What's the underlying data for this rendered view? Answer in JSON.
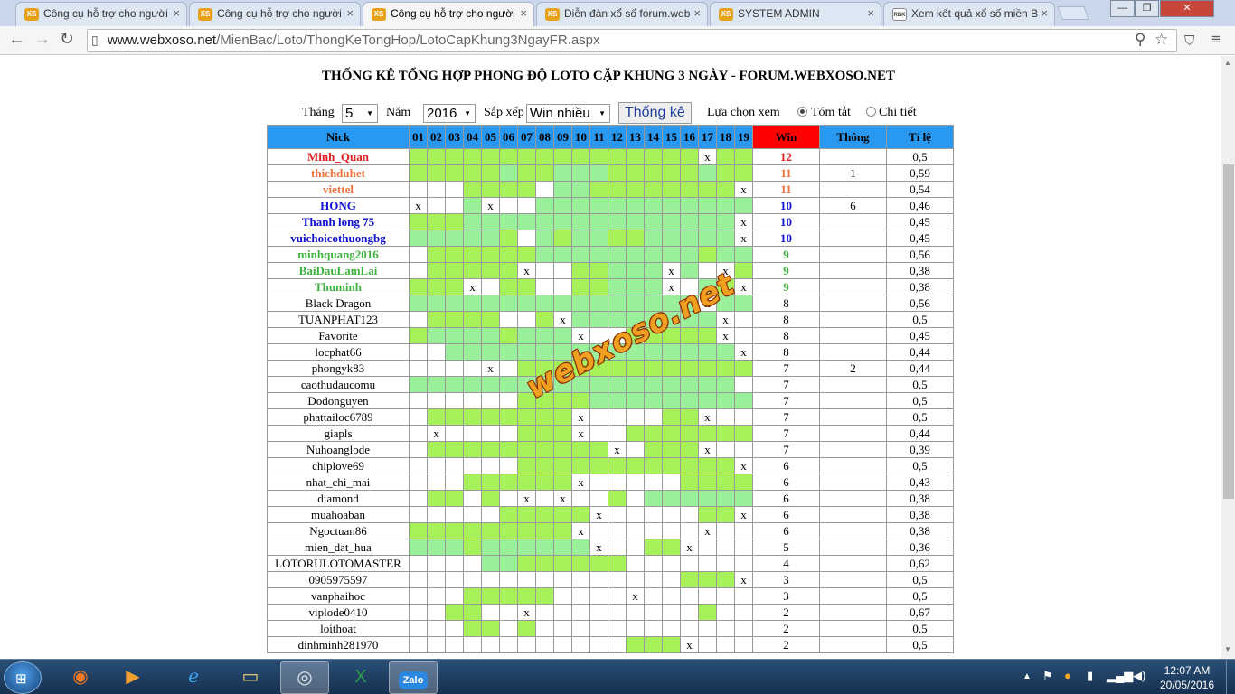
{
  "browser": {
    "tabs": [
      {
        "title": "Công cụ hỗ trợ cho người",
        "icon": "XS",
        "active": false
      },
      {
        "title": "Công cụ hỗ trợ cho người",
        "icon": "XS",
        "active": false
      },
      {
        "title": "Công cụ hỗ trợ cho người",
        "icon": "XS",
        "active": true
      },
      {
        "title": "Diễn đàn xổ số forum.web",
        "icon": "XS",
        "active": false
      },
      {
        "title": "SYSTEM ADMIN",
        "icon": "XS",
        "active": false
      },
      {
        "title": "Xem kết quả xổ số miền B",
        "icon": "RBK",
        "active": false
      }
    ],
    "url_host": "www.webxoso.net",
    "url_path": "/MienBac/Loto/ThongKeTongHop/LotoCapKhung3NgayFR.aspx"
  },
  "page": {
    "title": "THỐNG KÊ TỔNG HỢP PHONG ĐỘ LOTO CẶP KHUNG 3 NGÀY - FORUM.WEBXOSO.NET",
    "form": {
      "month_label": "Tháng",
      "month_value": "5",
      "year_label": "Năm",
      "year_value": "2016",
      "sort_label": "Sắp xếp",
      "sort_value": "Win nhiều",
      "submit_label": "Thống kê",
      "view_label": "Lựa chọn xem",
      "view_summary": "Tóm tắt",
      "view_detail": "Chi tiết"
    },
    "watermark": "webxoso.net",
    "table": {
      "headers": {
        "nick": "Nick",
        "win": "Win",
        "thong": "Thông",
        "ratio": "Tỉ lệ"
      },
      "days": [
        "01",
        "02",
        "03",
        "04",
        "05",
        "06",
        "07",
        "08",
        "09",
        "10",
        "11",
        "12",
        "13",
        "14",
        "15",
        "16",
        "17",
        "18",
        "19"
      ],
      "rows": [
        {
          "nick": "Minh_Quan",
          "cells": "GGGGGGGGGGGGGGGGxGG",
          "win": "12",
          "thong": "",
          "ratio": "0,5",
          "color": "#e02020",
          "bold": true
        },
        {
          "nick": "thichduhet",
          "cells": "GGGGGLGGLLLGGGGGLGG",
          "win": "11",
          "thong": "1",
          "ratio": "0,59",
          "color": "#f07040",
          "bold": true
        },
        {
          "nick": "viettel",
          "cells": "   GGGG LLGGGGGGGGx",
          "win": "11",
          "thong": "",
          "ratio": "0,54",
          "color": "#f07040",
          "bold": true
        },
        {
          "nick": "HONG",
          "cells": "x  Lx  LLLLLLLLLLLL",
          "win": "10",
          "thong": "6",
          "ratio": "0,46",
          "color": "#1010d0",
          "bold": true
        },
        {
          "nick": "Thanh long 75",
          "cells": "GGGLLLLLLLLLLLLLLLx",
          "win": "10",
          "thong": "",
          "ratio": "0,45",
          "color": "#1010d0",
          "bold": true
        },
        {
          "nick": "vuichoicothuongbg",
          "cells": "LLLLLG LGLLGGLLLLLx",
          "win": "10",
          "thong": "",
          "ratio": "0,45",
          "color": "#1010d0",
          "bold": true
        },
        {
          "nick": "minhquang2016",
          "cells": " GGGGGGLLLLLLLLLGLL",
          "win": "9",
          "thong": "",
          "ratio": "0,56",
          "color": "#40b040",
          "bold": true
        },
        {
          "nick": "BaiDauLamLai",
          "cells": " GGGGGx  GGLLLxL xG",
          "win": "9",
          "thong": "",
          "ratio": "0,38",
          "color": "#40b040",
          "bold": true
        },
        {
          "nick": "Thuminh",
          "cells": "GGGx GG  GGLLLx LGx",
          "win": "9",
          "thong": "",
          "ratio": "0,38",
          "color": "#40b040",
          "bold": true
        },
        {
          "nick": "Black Dragon",
          "cells": "LLLLLLLLLLLLLLLLxLL",
          "win": "8",
          "thong": "",
          "ratio": "0,56",
          "color": "#000",
          "bold": false
        },
        {
          "nick": "TUANPHAT123",
          "cells": " GGGG  GxLLLLLLLLx ",
          "win": "8",
          "thong": "",
          "ratio": "0,5",
          "color": "#000",
          "bold": false
        },
        {
          "nick": "Favorite",
          "cells": "GLLLLGLLLx  GGGGGx ",
          "win": "8",
          "thong": "",
          "ratio": "0,45",
          "color": "#000",
          "bold": false
        },
        {
          "nick": "locphat66",
          "cells": "  LLLLLLLLLLLLLLLLx",
          "win": "8",
          "thong": "",
          "ratio": "0,44",
          "color": "#000",
          "bold": false
        },
        {
          "nick": "phongyk83",
          "cells": "    x GGGGGGGGGGGGG",
          "win": "7",
          "thong": "2",
          "ratio": "0,44",
          "color": "#000",
          "bold": false
        },
        {
          "nick": "caothudaucomu",
          "cells": "LLLLLLLLLLLLLLLLLL ",
          "win": "7",
          "thong": "",
          "ratio": "0,5",
          "color": "#000",
          "bold": false
        },
        {
          "nick": "Dodonguyen",
          "cells": "      GGGGLLLLLLLLL",
          "win": "7",
          "thong": "",
          "ratio": "0,5",
          "color": "#000",
          "bold": false
        },
        {
          "nick": "phattailoc6789",
          "cells": " GGGGGGGGx    GGx  ",
          "win": "7",
          "thong": "",
          "ratio": "0,5",
          "color": "#000",
          "bold": false
        },
        {
          "nick": "giapls",
          "cells": " x    GGGx  GGGGGGG",
          "win": "7",
          "thong": "",
          "ratio": "0,44",
          "color": "#000",
          "bold": false
        },
        {
          "nick": "Nuhoanglode",
          "cells": " GGGGGGGGGGx GGGx  ",
          "win": "7",
          "thong": "",
          "ratio": "0,39",
          "color": "#000",
          "bold": false
        },
        {
          "nick": "chiplove69",
          "cells": "      GGGGGGGGGGGGx",
          "win": "6",
          "thong": "",
          "ratio": "0,5",
          "color": "#000",
          "bold": false
        },
        {
          "nick": "nhat_chi_mai",
          "cells": "   GGGGGGx     GGGG",
          "win": "6",
          "thong": "",
          "ratio": "0,43",
          "color": "#000",
          "bold": false
        },
        {
          "nick": "diamond",
          "cells": " GG G x x  G LLLLLL",
          "win": "6",
          "thong": "",
          "ratio": "0,38",
          "color": "#000",
          "bold": false
        },
        {
          "nick": "muahoaban",
          "cells": "     GGGGGx     GGx",
          "win": "6",
          "thong": "",
          "ratio": "0,38",
          "color": "#000",
          "bold": false
        },
        {
          "nick": "Ngoctuan86",
          "cells": "GGGGGGGGGx      x  ",
          "win": "6",
          "thong": "",
          "ratio": "0,38",
          "color": "#000",
          "bold": false
        },
        {
          "nick": "mien_dat_hua",
          "cells": "LLLGLLLLLLx  GGx   ",
          "win": "5",
          "thong": "",
          "ratio": "0,36",
          "color": "#000",
          "bold": false
        },
        {
          "nick": "LOTORULOTOMASTER",
          "cells": "    LLGGGGGG       ",
          "win": "4",
          "thong": "",
          "ratio": "0,62",
          "color": "#000",
          "bold": false
        },
        {
          "nick": "0905975597",
          "cells": "               GGGx",
          "win": "3",
          "thong": "",
          "ratio": "0,5",
          "color": "#000",
          "bold": false
        },
        {
          "nick": "vanphaihoc",
          "cells": "   GGGGG    x      ",
          "win": "3",
          "thong": "",
          "ratio": "0,5",
          "color": "#000",
          "bold": false
        },
        {
          "nick": "viplode0410",
          "cells": "  GG  x         G  ",
          "win": "2",
          "thong": "",
          "ratio": "0,67",
          "color": "#000",
          "bold": false
        },
        {
          "nick": "loithoat",
          "cells": "   GG G            ",
          "win": "2",
          "thong": "",
          "ratio": "0,5",
          "color": "#000",
          "bold": false
        },
        {
          "nick": "dinhminh281970",
          "cells": "            GGGx   ",
          "win": "2",
          "thong": "",
          "ratio": "0,5",
          "color": "#000",
          "bold": false
        }
      ]
    }
  },
  "taskbar": {
    "apps": [
      "firefox-icon",
      "media-player-icon",
      "ie-icon",
      "explorer-icon",
      "chrome-icon",
      "excel-icon",
      "zalo-icon"
    ],
    "zalo_label": "Zalo",
    "time": "12:07 AM",
    "date": "20/05/2016"
  }
}
